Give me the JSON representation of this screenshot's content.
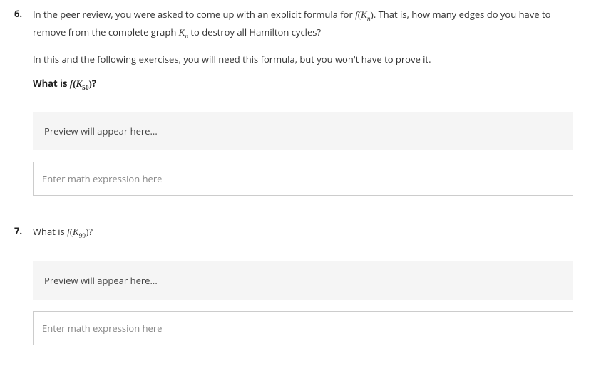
{
  "questions": [
    {
      "number": "6.",
      "text_parts": {
        "p1a": "In the peer review, you were asked to come up with an explicit formula for ",
        "fn1_f": "f",
        "fn1_lp": "(",
        "fn1_K": "K",
        "fn1_sub": "n",
        "fn1_rp": ")",
        "p1b": ". That is, how many edges do you have to remove from the complete graph ",
        "kn_K": "K",
        "kn_sub": "n",
        "p1c": " to destroy all Hamilton cycles?"
      },
      "subtext": "In this and the following exercises, you will need this formula, but you won't have to prove it.",
      "prompt": {
        "pre": "What is ",
        "f": "f",
        "lp": "(",
        "K": "K",
        "sub": "50",
        "rp": ")",
        "post": "?"
      },
      "preview": "Preview will appear here...",
      "placeholder": "Enter math expression here"
    },
    {
      "number": "7.",
      "prompt": {
        "pre": "What is ",
        "f": "f",
        "lp": "(",
        "K": "K",
        "sub": "99",
        "rp": ")",
        "post": "?"
      },
      "preview": "Preview will appear here...",
      "placeholder": "Enter math expression here"
    }
  ]
}
